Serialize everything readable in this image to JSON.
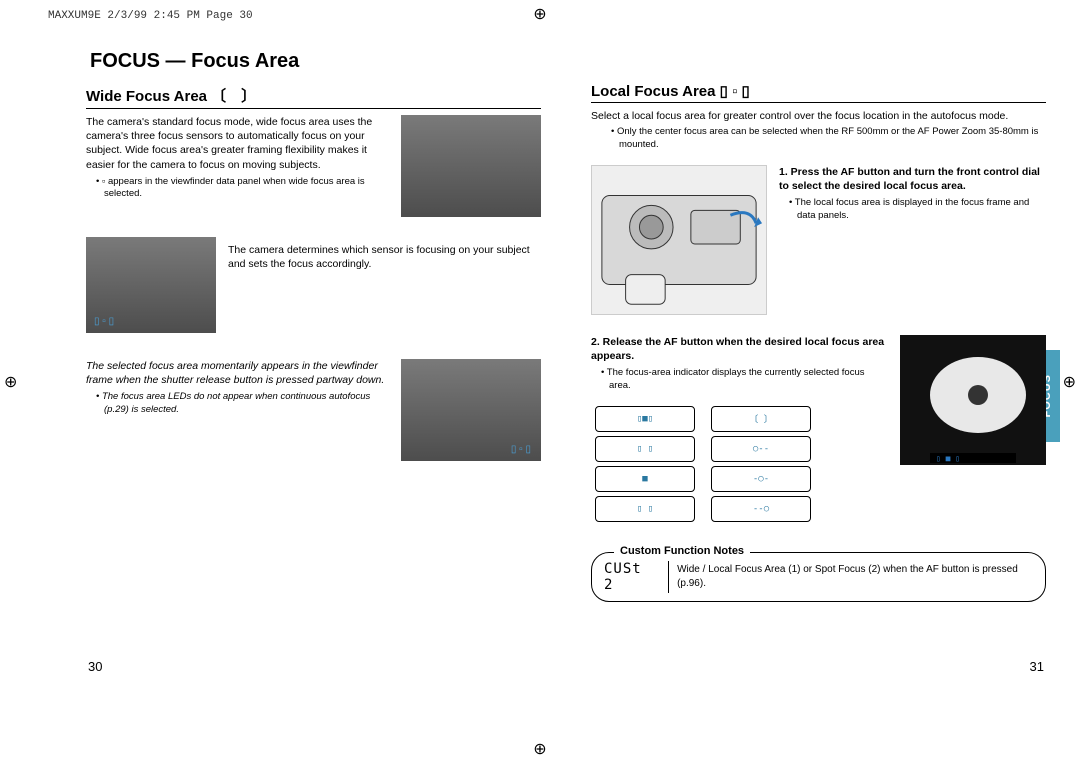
{
  "header": {
    "info": "MAXXUM9E  2/3/99 2:45 PM  Page 30"
  },
  "left": {
    "pageTitle": "FOCUS — Focus Area",
    "sectionTitle": "Wide Focus Area 〔　〕",
    "intro": "The camera's standard focus mode, wide focus area uses the camera's three focus sensors to automatically focus on your subject. Wide focus area's greater framing flexibility makes it easier for the camera to focus on moving subjects.",
    "introNote": "▫ appears in the viewfinder data panel when wide focus area is selected.",
    "midText": "The camera determines which sensor is focusing on your subject and sets the focus accordingly.",
    "italicNote": "The selected focus area momentarily appears in the viewfinder frame when the shutter release button is pressed partway down.",
    "italicBullet": "The focus area LEDs do not appear when continuous autofocus (p.29) is selected.",
    "pageNum": "30"
  },
  "right": {
    "sectionTitle": "Local Focus Area ▯ ▫ ▯",
    "intro": "Select a local focus area for greater control over the focus location in the autofocus mode.",
    "introNote": "Only the center focus area can be selected when the RF 500mm or the AF Power Zoom 35-80mm is mounted.",
    "step1": "1. Press the AF button and turn the front control dial to select the desired local focus area.",
    "step1Note": "The local focus area is displayed in the focus frame and data panels.",
    "step2": "2. Release the AF button when the desired local focus area appears.",
    "step2Note": "The focus-area indicator displays the currently selected focus area.",
    "customLabel": "Custom Function Notes",
    "custIcon": "CUSt 2",
    "customText": "Wide / Local Focus Area (1) or Spot Focus (2) when the AF button is pressed (p.96).",
    "pageNum": "31"
  },
  "sideTab": "FOCUS"
}
